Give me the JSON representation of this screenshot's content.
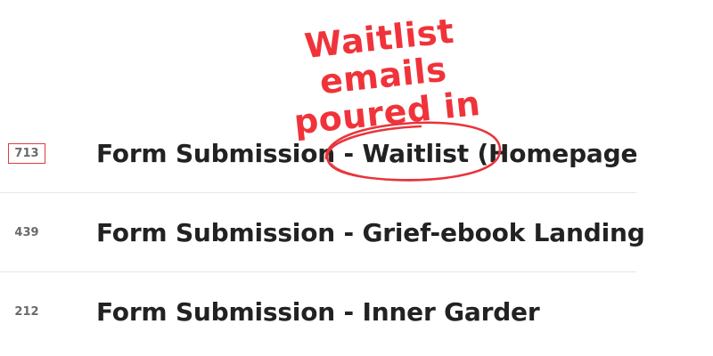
{
  "annotation": {
    "line1": "Waitlist emails",
    "line2": "poured in",
    "color": "#f0333a"
  },
  "rows": [
    {
      "count": "713",
      "title": "Form Submission - Waitlist (Homepage",
      "highlighted": true
    },
    {
      "count": "439",
      "title": "Form Submission - Grief-ebook Landing"
    },
    {
      "count": "212",
      "title": "Form Submission - Inner Garder"
    }
  ]
}
